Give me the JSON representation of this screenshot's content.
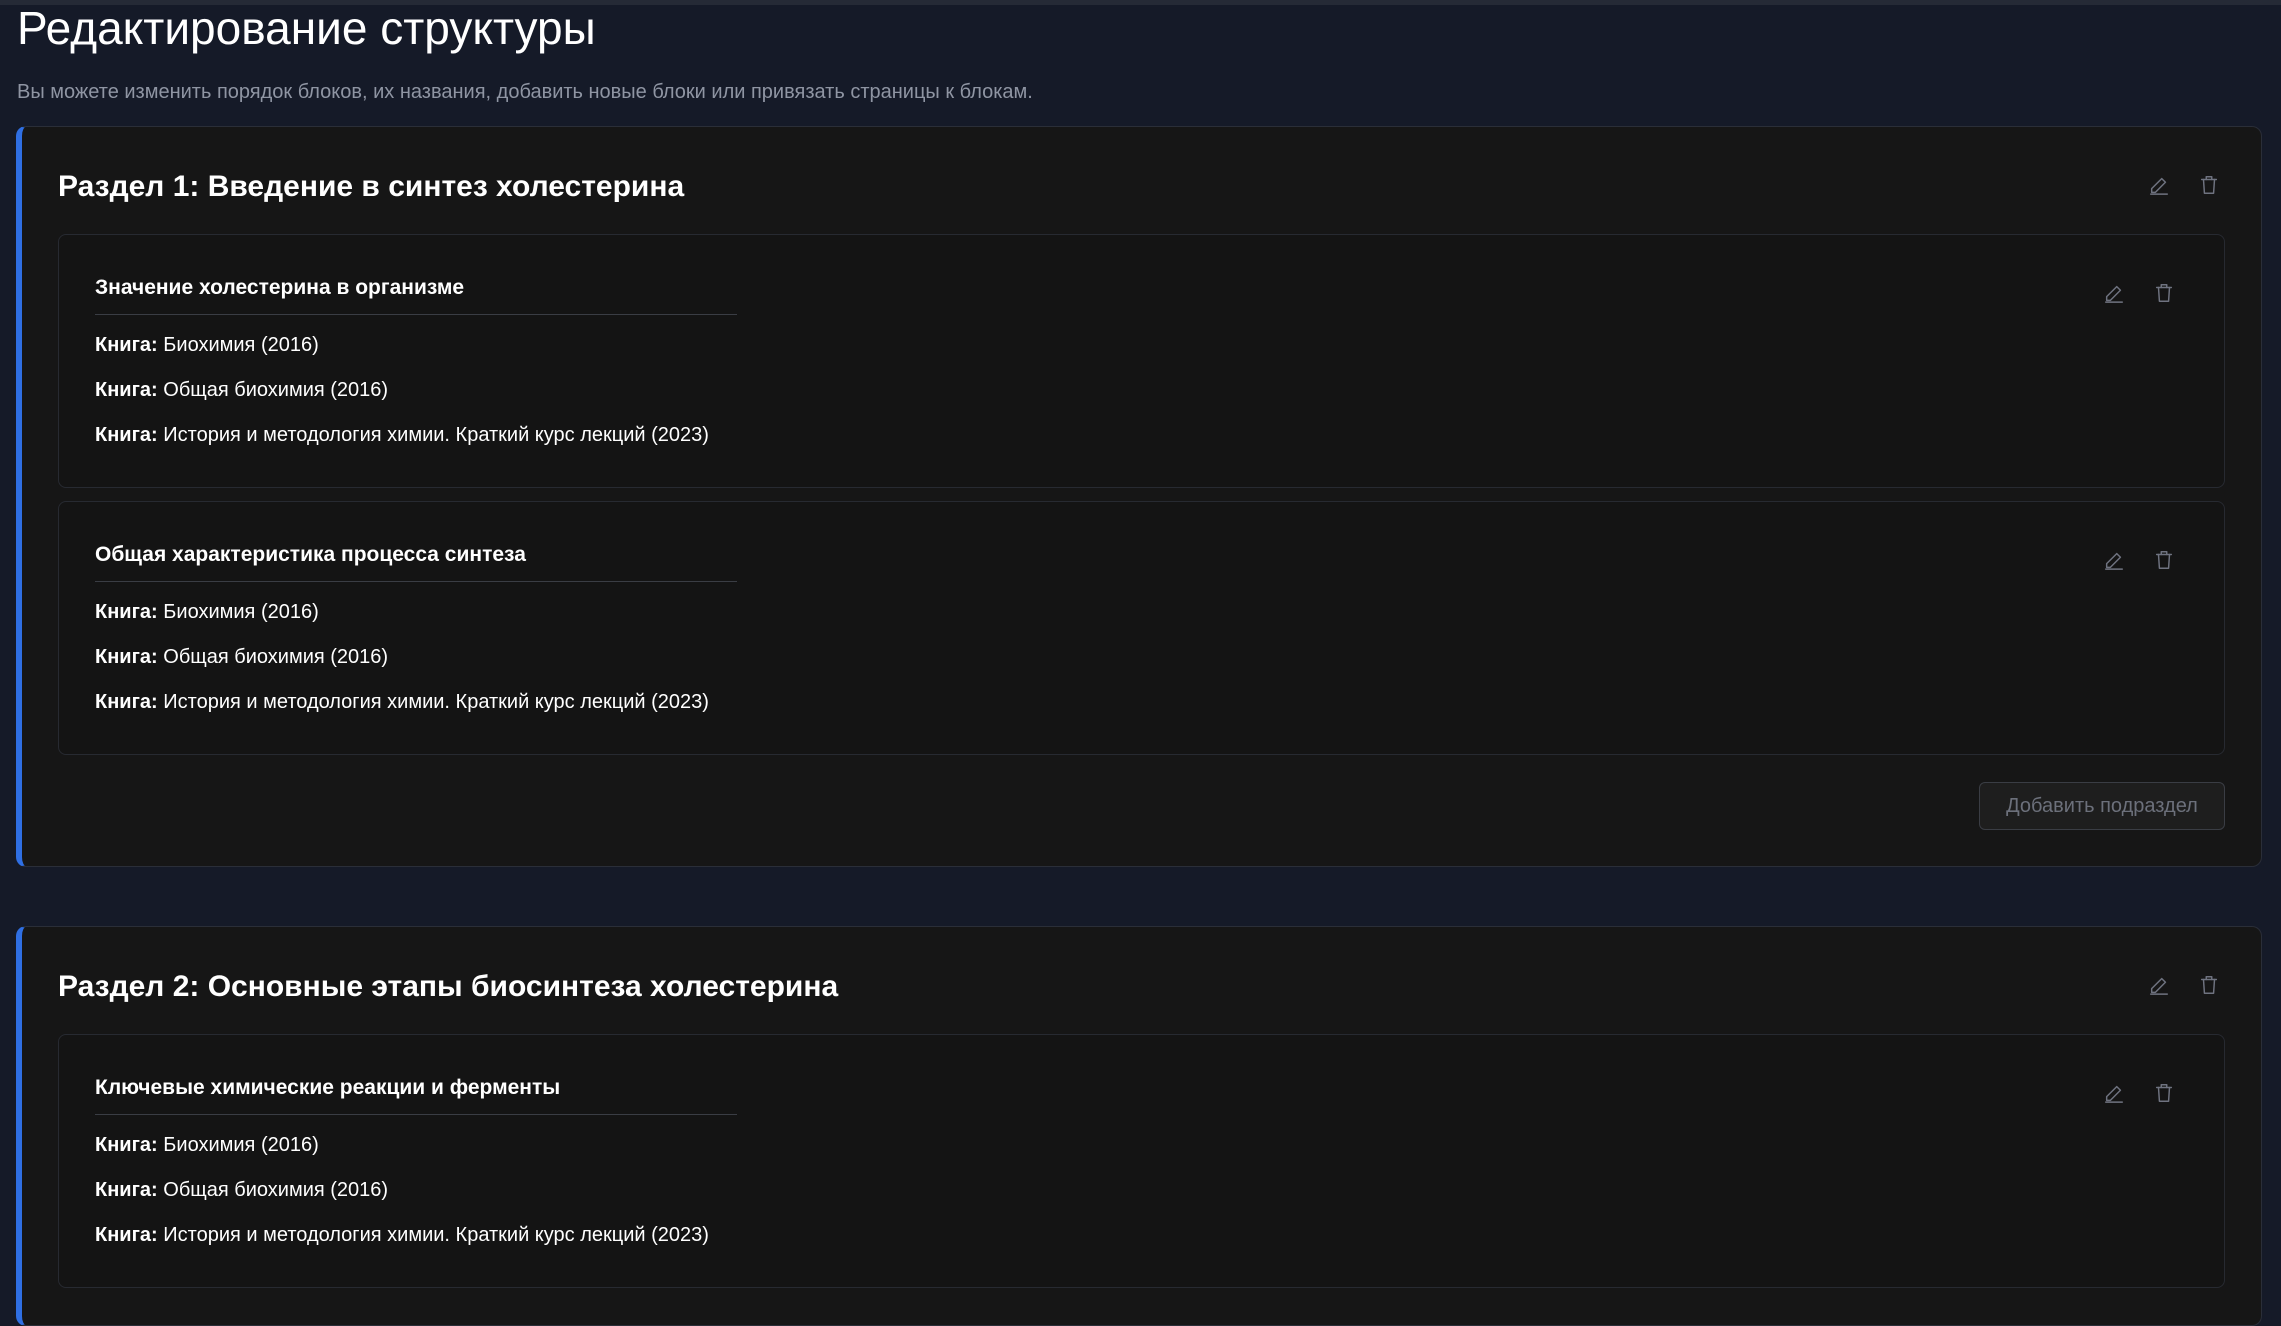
{
  "page": {
    "title": "Редактирование структуры",
    "subtitle": "Вы можете изменить порядок блоков, их названия, добавить новые блоки или привязать страницы к блокам."
  },
  "sections": [
    {
      "title": "Раздел 1: Введение в синтез холестерина",
      "subsections": [
        {
          "title": "Значение холестерина в организме",
          "books": [
            {
              "label": "Книга:",
              "value": "Биохимия (2016)"
            },
            {
              "label": "Книга:",
              "value": "Общая биохимия (2016)"
            },
            {
              "label": "Книга:",
              "value": "История и методология химии. Краткий курс лекций (2023)"
            }
          ]
        },
        {
          "title": "Общая характеристика процесса синтеза",
          "books": [
            {
              "label": "Книга:",
              "value": "Биохимия (2016)"
            },
            {
              "label": "Книга:",
              "value": "Общая биохимия (2016)"
            },
            {
              "label": "Книга:",
              "value": "История и методология химии. Краткий курс лекций (2023)"
            }
          ]
        }
      ],
      "add_subsection_label": "Добавить подраздел"
    },
    {
      "title": "Раздел 2: Основные этапы биосинтеза холестерина",
      "subsections": [
        {
          "title": "Ключевые химические реакции и ферменты",
          "books": [
            {
              "label": "Книга:",
              "value": "Биохимия (2016)"
            },
            {
              "label": "Книга:",
              "value": "Общая биохимия (2016)"
            },
            {
              "label": "Книга:",
              "value": "История и методология химии. Краткий курс лекций (2023)"
            }
          ]
        }
      ]
    }
  ],
  "icons": {
    "edit": "pencil-icon",
    "delete": "trash-icon"
  },
  "colors": {
    "background": "#151a28",
    "card": "#161616",
    "accent": "#2f6fe3",
    "muted_text": "#8f95a3"
  }
}
